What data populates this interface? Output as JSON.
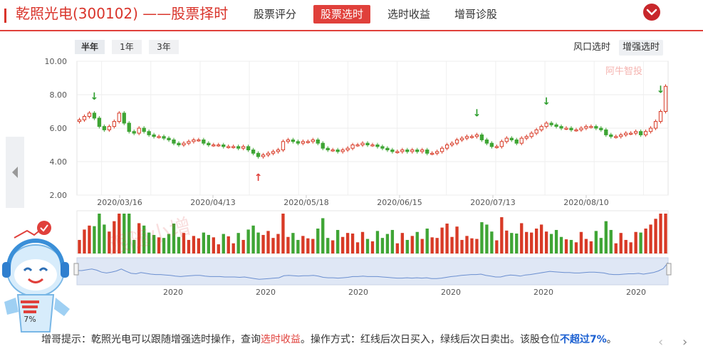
{
  "header": {
    "title": "乾照光电(300102) ——股票择时",
    "nav": [
      "股票评分",
      "股票选时",
      "选时收益",
      "增哥诊股"
    ],
    "active_nav": 1,
    "accent_color": "#e0403b"
  },
  "ranges": {
    "items": [
      "半年",
      "1年",
      "3年"
    ],
    "active": 0
  },
  "modes": {
    "items": [
      "风口选时",
      "增强选时"
    ],
    "active": 1
  },
  "chart_data": {
    "type": "candlestick",
    "y_ticks": [
      "10.00",
      "8.00",
      "6.00",
      "4.00",
      "2.00"
    ],
    "ylim": [
      2,
      10
    ],
    "x_labels": [
      "2020/03/16",
      "2020/04/13",
      "2020/05/18",
      "2020/06/15",
      "2020/07/13",
      "2020/08/10"
    ],
    "watermark": "阿牛智投",
    "stamp": "跟随小增",
    "closes": [
      6.5,
      6.7,
      6.9,
      6.6,
      6.1,
      5.9,
      6.1,
      6.4,
      6.9,
      6.3,
      5.8,
      5.7,
      6.0,
      5.8,
      5.6,
      5.5,
      5.5,
      5.4,
      5.3,
      5.1,
      5.0,
      5.1,
      5.2,
      5.3,
      5.3,
      5.1,
      5.0,
      5.0,
      5.0,
      4.9,
      4.9,
      4.9,
      4.8,
      4.9,
      4.7,
      4.5,
      4.3,
      4.4,
      4.5,
      4.6,
      4.7,
      5.2,
      5.3,
      5.2,
      5.1,
      5.2,
      5.2,
      5.3,
      5.1,
      4.8,
      4.7,
      4.7,
      4.6,
      4.7,
      4.8,
      5.0,
      5.0,
      5.1,
      5.0,
      5.0,
      4.9,
      4.8,
      4.7,
      4.6,
      4.6,
      4.7,
      4.6,
      4.7,
      4.6,
      4.7,
      4.5,
      4.5,
      4.6,
      4.8,
      5.0,
      5.1,
      5.3,
      5.4,
      5.5,
      5.5,
      5.6,
      5.3,
      5.1,
      4.9,
      4.9,
      5.2,
      5.4,
      5.3,
      5.1,
      5.4,
      5.5,
      5.7,
      5.9,
      6.1,
      6.3,
      6.2,
      6.1,
      6.0,
      6.0,
      5.9,
      5.9,
      6.0,
      6.1,
      6.1,
      6.0,
      5.9,
      5.6,
      5.5,
      5.5,
      5.6,
      5.7,
      5.7,
      5.8,
      5.6,
      5.8,
      6.0,
      6.4,
      7.0,
      8.5
    ],
    "signals": [
      {
        "index": 3,
        "type": "sell",
        "label": "↓"
      },
      {
        "index": 36,
        "type": "buy",
        "label": "↑"
      },
      {
        "index": 80,
        "type": "sell",
        "label": "↓"
      },
      {
        "index": 94,
        "type": "sell",
        "label": "↓"
      },
      {
        "index": 117,
        "type": "sell",
        "label": "↓"
      }
    ],
    "colors": {
      "up": "#d83a26",
      "down": "#3fa535"
    },
    "navigator_labels": [
      "2020",
      "2020",
      "2020",
      "2020",
      "2020",
      "2020"
    ]
  },
  "mascot": {
    "position_label": "7%"
  },
  "tip": {
    "prefix": "增哥提示：乾照光电可以跟随增强选时操作，查询",
    "link": "选时收益",
    "middle": "。操作方式：红线后次日买入，绿线后次日卖出。该股仓位",
    "highlight": "不超过7%",
    "suffix": "。"
  }
}
